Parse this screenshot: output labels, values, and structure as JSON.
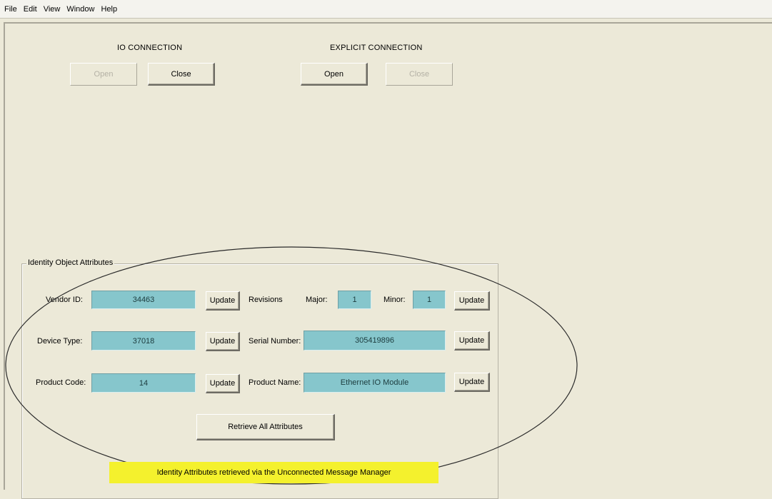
{
  "menu": [
    "File",
    "Edit",
    "View",
    "Window",
    "Help"
  ],
  "io_connection": {
    "title": "IO CONNECTION",
    "open_label": "Open",
    "close_label": "Close"
  },
  "explicit_connection": {
    "title": "EXPLICIT CONNECTION",
    "open_label": "Open",
    "close_label": "Close"
  },
  "identity": {
    "group_title": "Identity Object Attributes",
    "vendor_id_label": "Vendor ID:",
    "vendor_id_value": "34463",
    "device_type_label": "Device Type:",
    "device_type_value": "37018",
    "product_code_label": "Product Code:",
    "product_code_value": "14",
    "revisions_label": "Revisions",
    "major_label": "Major:",
    "major_value": "1",
    "minor_label": "Minor:",
    "minor_value": "1",
    "serial_number_label": "Serial Number:",
    "serial_number_value": "305419896",
    "product_name_label": "Product Name:",
    "product_name_value": "Ethernet IO Module",
    "update_label": "Update",
    "retrieve_all_label": "Retrieve All Attributes"
  },
  "annotation": {
    "text": "Identity Attributes retrieved via the Unconnected Message Manager",
    "highlight_color": "#f4f12d"
  },
  "colors": {
    "window_bg": "#ece9d8",
    "value_box_bg": "#86c6cc"
  }
}
